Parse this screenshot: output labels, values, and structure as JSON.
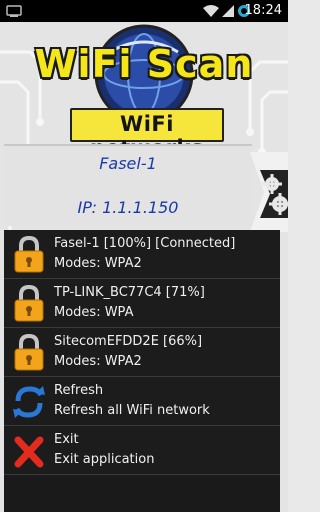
{
  "status_bar": {
    "time": "18:24",
    "icons": [
      "wifi-icon",
      "signal-icon",
      "alarm-icon"
    ]
  },
  "header": {
    "app_title": "WiFi Scan",
    "subtitle": "WiFi networks"
  },
  "connection": {
    "network_name": "Fasel-1",
    "ip": "IP: 1.1.1.150"
  },
  "networks": [
    {
      "title": "Fasel-1 [100%] [Connected]",
      "modes": "Modes: WPA2",
      "icon": "lock-icon"
    },
    {
      "title": "TP-LINK_BC77C4 [71%]",
      "modes": "Modes: WPA",
      "icon": "lock-icon"
    },
    {
      "title": "SitecomEFDD2E [66%]",
      "modes": "Modes: WPA2",
      "icon": "lock-icon"
    }
  ],
  "actions": [
    {
      "title": "Refresh",
      "subtitle": "Refresh all WiFi network",
      "icon": "refresh-icon"
    },
    {
      "title": "Exit",
      "subtitle": "Exit application",
      "icon": "close-icon"
    }
  ],
  "colors": {
    "accent_yellow": "#f5e61a",
    "link_blue": "#1b3aa8",
    "list_bg": "#1c1c1c"
  }
}
